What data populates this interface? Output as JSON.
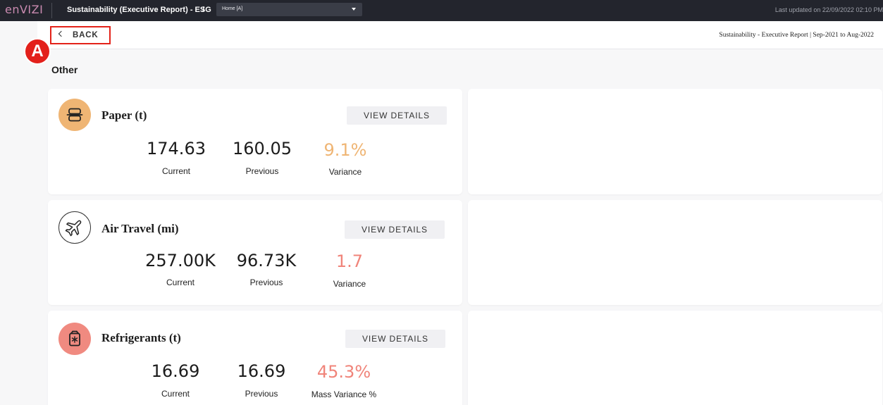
{
  "app": {
    "logo": "enVIZI",
    "breadcrumb": "Sustainability (Executive Report) - ESG",
    "breadcrumb_separator": "/",
    "dropdown_value": "Home [A]",
    "last_updated": "Last updated on 22/09/2022 02:10 PM"
  },
  "subheader": {
    "back_label": "BACK",
    "report_title": "Sustainability - Executive Report | Sep-2021 to Aug-2022",
    "annotation_badge": "A"
  },
  "section_title": "Other",
  "cards": [
    {
      "title": "Paper (t)",
      "icon": "paper-stack-icon",
      "icon_bg": "#efb574",
      "button": "VIEW DETAILS",
      "current": "174.63",
      "current_label": "Current",
      "previous": "160.05",
      "previous_label": "Previous",
      "variance": "9.1%",
      "variance_label": "Variance",
      "variance_color": "#efb574"
    },
    {
      "title": "Air Travel (mi)",
      "icon": "airplane-icon",
      "icon_bg": "#ffffff",
      "button": "VIEW DETAILS",
      "current": "257.00K",
      "current_label": "Current",
      "previous": "96.73K",
      "previous_label": "Previous",
      "variance": "1.7",
      "variance_label": "Variance",
      "variance_color": "#f0847a"
    },
    {
      "title": "Refrigerants (t)",
      "icon": "refrigerant-canister-icon",
      "icon_bg": "#f08a80",
      "button": "VIEW DETAILS",
      "current": "16.69",
      "current_label": "Current",
      "previous": "16.69",
      "previous_label": "Previous",
      "variance": "45.3%",
      "variance_label": "Mass Variance %",
      "variance_color": "#f0847a"
    }
  ]
}
